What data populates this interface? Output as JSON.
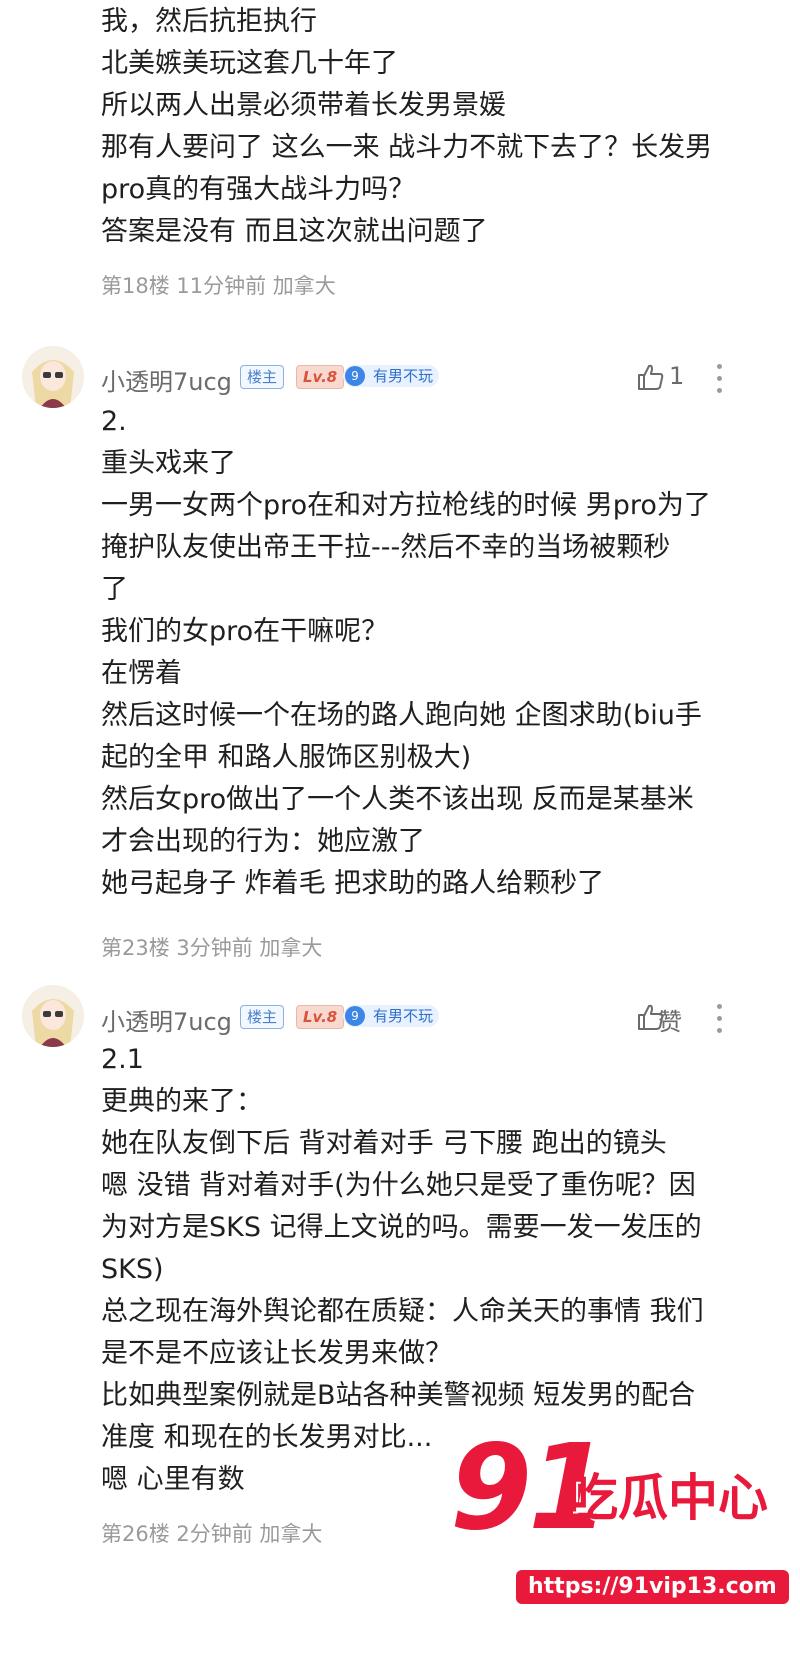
{
  "post18": {
    "lines": [
      "我，然后抗拒执行",
      "北美嫉美玩这套几十年了",
      "所以两人出景必须带着长发男景媛",
      "那有人要问了 这么一来 战斗力不就下去了？长发男",
      "pro真的有强大战斗力吗？",
      "答案是没有 而且这次就出问题了"
    ],
    "meta": "第18楼  11分钟前  加拿大"
  },
  "post23": {
    "username": "小透明7ucg",
    "badge_host": "楼主",
    "badge_level": "Lv.8",
    "club_level": "9",
    "club_name": "有男不玩",
    "like_count": "1",
    "lines": [
      "2.",
      "重头戏来了",
      "一男一女两个pro在和对方拉枪线的时候 男pro为了",
      "掩护队友使出帝王干拉---然后不幸的当场被颗秒",
      "了",
      "我们的女pro在干嘛呢？",
      "在愣着",
      "然后这时候一个在场的路人跑向她 企图求助(biu手",
      "起的全甲 和路人服饰区别极大)",
      "然后女pro做出了一个人类不该出现 反而是某基米",
      "才会出现的行为：她应激了",
      "她弓起身子 炸着毛 把求助的路人给颗秒了"
    ],
    "meta": "第23楼  3分钟前  加拿大"
  },
  "post26": {
    "username": "小透明7ucg",
    "badge_host": "楼主",
    "badge_level": "Lv.8",
    "club_level": "9",
    "club_name": "有男不玩",
    "like_label": "赞",
    "lines": [
      "2.1",
      "更典的来了：",
      "她在队友倒下后 背对着对手 弓下腰 跑出的镜头",
      "嗯 没错 背对着对手(为什么她只是受了重伤呢？因",
      "为对方是SKS 记得上文说的吗。需要一发一发压的",
      "SKS)",
      "总之现在海外舆论都在质疑：人命关天的事情 我们",
      "是不是不应该让长发男来做？",
      "比如典型案例就是B站各种美警视频 短发男的配合",
      "准度 和现在的长发男对比...",
      "嗯 心里有数"
    ],
    "meta": "第26楼  2分钟前  加拿大"
  },
  "watermark": {
    "number": "91",
    "text": "吃瓜中心",
    "url": "https://91vip13.com"
  },
  "colors": {
    "watermark_red": "#e8193a",
    "meta_gray": "#9a9a9a"
  },
  "icons": [
    "thumb-up-icon",
    "more-vertical-icon",
    "avatar-image"
  ]
}
